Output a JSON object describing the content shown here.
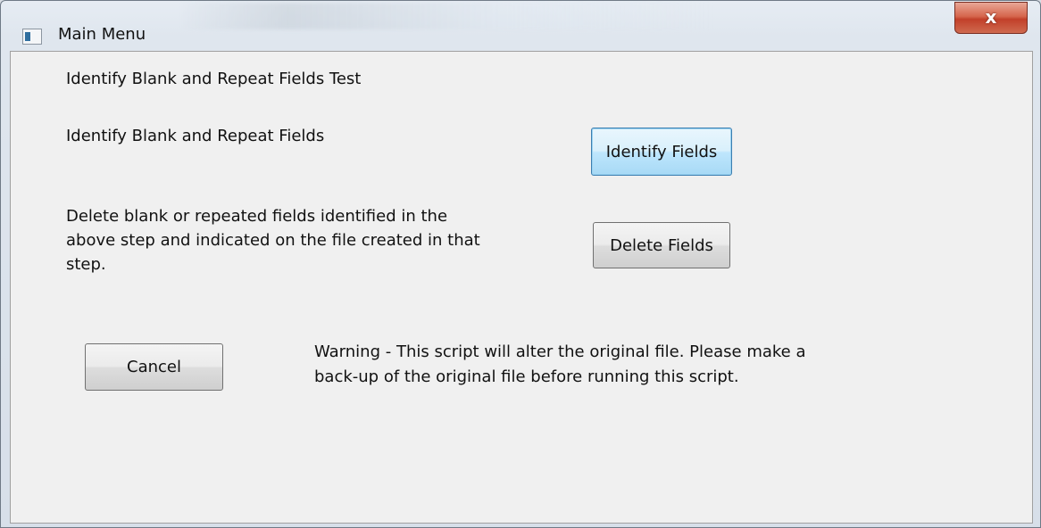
{
  "window": {
    "title": "Main Menu",
    "close_label": "x"
  },
  "content": {
    "heading": "Identify Blank and Repeat Fields Test",
    "identify_description": "Identify Blank and Repeat Fields",
    "delete_description_line1": "Delete blank or repeated fields identified in the",
    "delete_description_line2": "above step and indicated on the file created in that",
    "delete_description_line3": "step.",
    "warning_line1": "Warning - This script will alter the original file.  Please make a",
    "warning_line2": "back-up of the original file before running this script."
  },
  "buttons": {
    "identify_label": "Identify Fields",
    "delete_label": "Delete Fields",
    "cancel_label": "Cancel"
  }
}
